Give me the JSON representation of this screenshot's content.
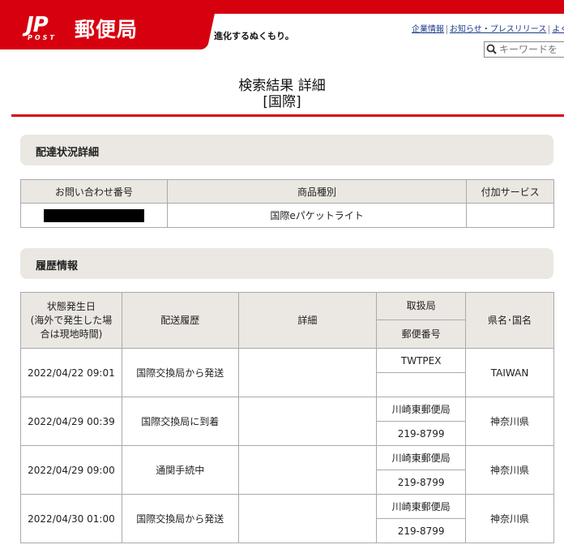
{
  "header": {
    "logo_mark": "JP",
    "logo_post": "POST",
    "logo_name": "郵便局",
    "tagline": "進化するぬくもり。",
    "links": [
      "企業情報",
      "お知らせ・プレスリリース",
      "よくあ"
    ],
    "search_placeholder": "キーワードを"
  },
  "title": {
    "line1": "検索結果 詳細",
    "line2": "[国際]"
  },
  "delivery_section": {
    "heading": "配達状況詳細",
    "columns": [
      "お問い合わせ番号",
      "商品種別",
      "付加サービス"
    ],
    "row": {
      "product_type": "国際eパケットライト",
      "service": ""
    }
  },
  "history_section": {
    "heading": "履歴情報",
    "columns": {
      "date": "状態発生日\n(海外で発生した場合は現地時間)",
      "date_line1": "状態発生日",
      "date_line2": "(海外で発生した場",
      "date_line3": "合は現地時間)",
      "status": "配送履歴",
      "detail": "詳細",
      "office": "取扱局",
      "postal": "郵便番号",
      "region": "県名･国名"
    },
    "rows": [
      {
        "date": "2022/04/22 09:01",
        "status": "国際交換局から発送",
        "detail": "",
        "office": "TWTPEX",
        "postal": "",
        "region": "TAIWAN"
      },
      {
        "date": "2022/04/29 00:39",
        "status": "国際交換局に到着",
        "detail": "",
        "office": "川崎東郵便局",
        "postal": "219-8799",
        "region": "神奈川県"
      },
      {
        "date": "2022/04/29 09:00",
        "status": "通関手続中",
        "detail": "",
        "office": "川崎東郵便局",
        "postal": "219-8799",
        "region": "神奈川県"
      },
      {
        "date": "2022/04/30 01:00",
        "status": "国際交換局から発送",
        "detail": "",
        "office": "川崎東郵便局",
        "postal": "219-8799",
        "region": "神奈川県"
      }
    ]
  }
}
